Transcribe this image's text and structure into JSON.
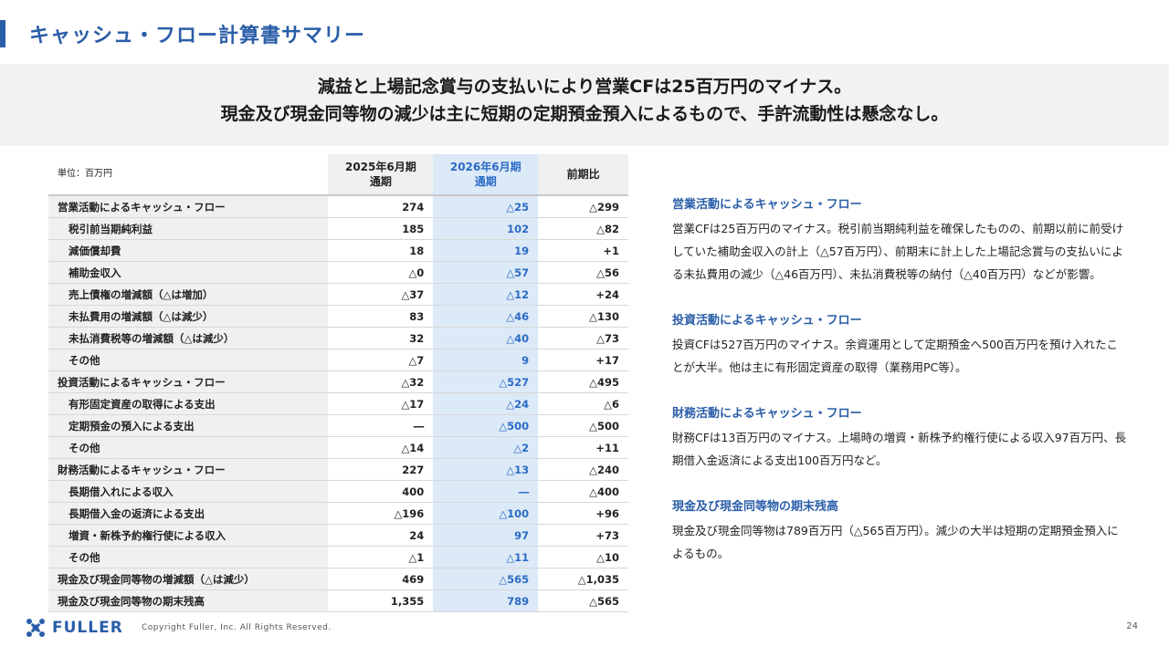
{
  "title": "キャッシュ・フロー計算書サマリー",
  "headline": {
    "line1": "減益と上場記念賞与の支払いにより営業CFは25百万円のマイナス。",
    "line2": "現金及び現金同等物の減少は主に短期の定期預金預入によるもので、手許流動性は懸念なし。"
  },
  "table": {
    "unit": "単位：百万円",
    "col_prev": "2025年6月期\n通期",
    "col_cur": "2026年6月期\n通期",
    "col_diff": "前期比",
    "rows": [
      {
        "label": "営業活動によるキャッシュ・フロー",
        "prev": "274",
        "cur": "△25",
        "diff": "△299"
      },
      {
        "label": "税引前当期純利益",
        "prev": "185",
        "cur": "102",
        "diff": "△82"
      },
      {
        "label": "減価償却費",
        "prev": "18",
        "cur": "19",
        "diff": "+1"
      },
      {
        "label": "補助金収入",
        "prev": "△0",
        "cur": "△57",
        "diff": "△56"
      },
      {
        "label": "売上債権の増減額（△は増加）",
        "prev": "△37",
        "cur": "△12",
        "diff": "+24"
      },
      {
        "label": "未払費用の増減額（△は減少）",
        "prev": "83",
        "cur": "△46",
        "diff": "△130"
      },
      {
        "label": "未払消費税等の増減額（△は減少）",
        "prev": "32",
        "cur": "△40",
        "diff": "△73"
      },
      {
        "label": "その他",
        "prev": "△7",
        "cur": "9",
        "diff": "+17"
      },
      {
        "label": "投資活動によるキャッシュ・フロー",
        "prev": "△32",
        "cur": "△527",
        "diff": "△495"
      },
      {
        "label": "有形固定資産の取得による支出",
        "prev": "△17",
        "cur": "△24",
        "diff": "△6"
      },
      {
        "label": "定期預金の預入による支出",
        "prev": "―",
        "cur": "△500",
        "diff": "△500"
      },
      {
        "label": "その他",
        "prev": "△14",
        "cur": "△2",
        "diff": "+11"
      },
      {
        "label": "財務活動によるキャッシュ・フロー",
        "prev": "227",
        "cur": "△13",
        "diff": "△240"
      },
      {
        "label": "長期借入れによる収入",
        "prev": "400",
        "cur": "―",
        "diff": "△400"
      },
      {
        "label": "長期借入金の返済による支出",
        "prev": "△196",
        "cur": "△100",
        "diff": "+96"
      },
      {
        "label": "増資・新株予約権行使による収入",
        "prev": "24",
        "cur": "97",
        "diff": "+73"
      },
      {
        "label": "その他",
        "prev": "△1",
        "cur": "△11",
        "diff": "△10"
      },
      {
        "label": "現金及び現金同等物の増減額（△は減少）",
        "prev": "469",
        "cur": "△565",
        "diff": "△1,035"
      },
      {
        "label": "現金及び現金同等物の期末残高",
        "prev": "1,355",
        "cur": "789",
        "diff": "△565"
      }
    ]
  },
  "sections": [
    {
      "title": "営業活動によるキャッシュ・フロー",
      "body": "営業CFは25百万円のマイナス。税引前当期純利益を確保したものの、前期以前に前受けしていた補助金収入の計上（△57百万円）、前期末に計上した上場記念賞与の支払いによる未払費用の減少（△46百万円）、未払消費税等の納付（△40百万円）などが影響。"
    },
    {
      "title": "投資活動によるキャッシュ・フロー",
      "body": "投資CFは527百万円のマイナス。余資運用として定期預金へ500百万円を預け入れたことが大半。他は主に有形固定資産の取得（業務用PC等）。"
    },
    {
      "title": "財務活動によるキャッシュ・フロー",
      "body": "財務CFは13百万円のマイナス。上場時の増資・新株予約権行使による収入97百万円、長期借入金返済による支出100百万円など。"
    },
    {
      "title": "現金及び現金同等物の期末残高",
      "body": "現金及び現金同等物は789百万円（△565百万円）。減少の大半は短期の定期預金預入によるもの。"
    }
  ],
  "footer": {
    "logo": "FULLER",
    "copyright": "Copyright Fuller, Inc. All Rights Reserved.",
    "page": "24"
  },
  "colors": {
    "accent": "#2a5ea8",
    "highlight_col": "#dce9f7",
    "highlight_text": "#2a6bc4"
  },
  "icons": {
    "logo": "fuller-logo-icon"
  }
}
